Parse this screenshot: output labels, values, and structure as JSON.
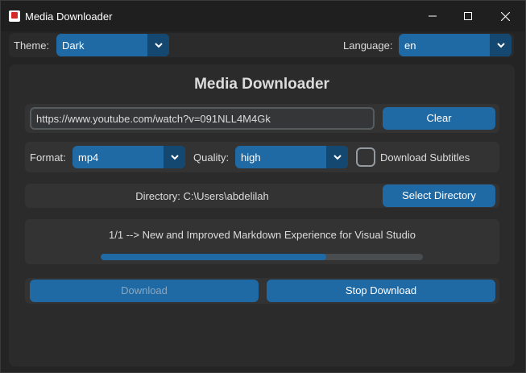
{
  "window": {
    "title": "Media Downloader"
  },
  "topbar": {
    "theme_label": "Theme:",
    "theme_value": "Dark",
    "language_label": "Language:",
    "language_value": "en"
  },
  "main": {
    "title": "Media Downloader",
    "url": "https://www.youtube.com/watch?v=091NLL4M4Gk",
    "clear_label": "Clear",
    "format_label": "Format:",
    "format_value": "mp4",
    "quality_label": "Quality:",
    "quality_value": "high",
    "subtitles_label": "Download Subtitles",
    "subtitles_checked": false,
    "directory_text": "Directory: C:\\Users\\abdelilah",
    "select_directory_label": "Select Directory",
    "status_text": "1/1 --> New and Improved Markdown Experience for Visual Studio",
    "progress_fraction": 0.7,
    "download_label": "Download",
    "stop_download_label": "Stop Download"
  },
  "colors": {
    "accent": "#1f6aa5",
    "accent_dark": "#144870",
    "window_bg": "#242424",
    "frame_bg": "#2b2b2b"
  },
  "icons": {
    "app": "app-icon",
    "minimize": "minimize-icon",
    "maximize": "maximize-icon",
    "close": "close-icon",
    "dropdown": "chevron-down-icon"
  }
}
